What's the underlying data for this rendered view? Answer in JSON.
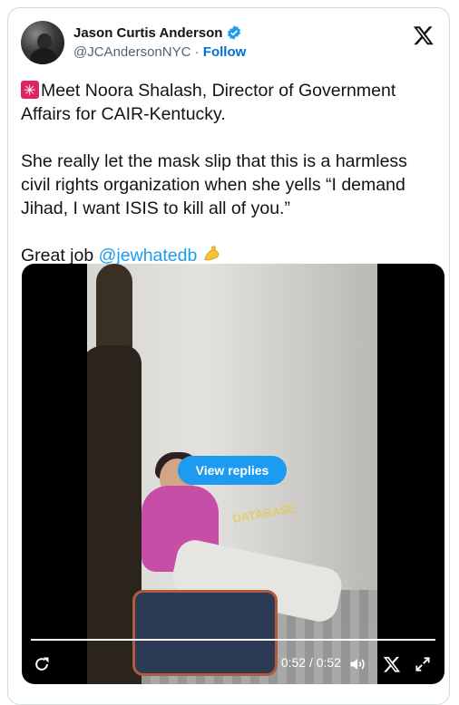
{
  "author": {
    "name": "Jason Curtis Anderson",
    "handle": "@JCAndersonNYC",
    "separator": "·",
    "follow_label": "Follow",
    "verified": true
  },
  "tweet": {
    "line1": "Meet Noora Shalash, Director of Government Affairs for CAIR-Kentucky.",
    "line2": "She really let the mask slip that this is a harmless civil rights organization when she yells “I demand Jihad, I want ISIS to kill all of you.”",
    "line3_prefix": "Great job ",
    "mention": "@jewhatedb"
  },
  "video": {
    "view_replies_label": "View replies",
    "watermark": "DATABASE",
    "time_display": "0:52 / 0:52",
    "progress": 1.0
  },
  "icons": {
    "siren": "siren-emoji",
    "flex": "flexed-biceps-emoji",
    "x_logo": "x-logo",
    "replay": "replay-icon",
    "volume": "volume-icon",
    "x_small": "x-logo-small",
    "expand": "expand-icon"
  },
  "colors": {
    "accent": "#1d9bf0",
    "follow": "#006fd6",
    "text": "#0f1419",
    "muted": "#536471"
  }
}
